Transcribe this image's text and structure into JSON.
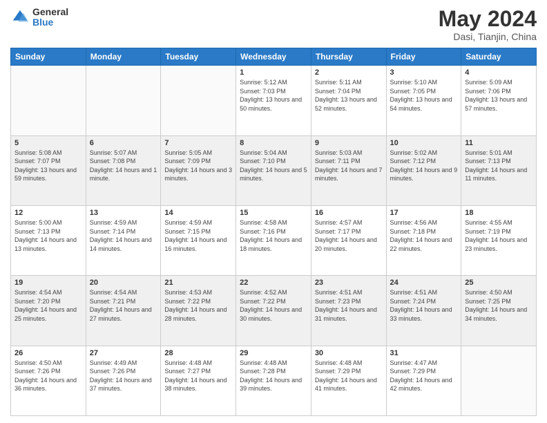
{
  "header": {
    "logo_general": "General",
    "logo_blue": "Blue",
    "month_title": "May 2024",
    "location": "Dasi, Tianjin, China"
  },
  "calendar": {
    "headers": [
      "Sunday",
      "Monday",
      "Tuesday",
      "Wednesday",
      "Thursday",
      "Friday",
      "Saturday"
    ],
    "rows": [
      [
        {
          "day": "",
          "sunrise": "",
          "sunset": "",
          "daylight": ""
        },
        {
          "day": "",
          "sunrise": "",
          "sunset": "",
          "daylight": ""
        },
        {
          "day": "",
          "sunrise": "",
          "sunset": "",
          "daylight": ""
        },
        {
          "day": "1",
          "sunrise": "Sunrise: 5:12 AM",
          "sunset": "Sunset: 7:03 PM",
          "daylight": "Daylight: 13 hours and 50 minutes."
        },
        {
          "day": "2",
          "sunrise": "Sunrise: 5:11 AM",
          "sunset": "Sunset: 7:04 PM",
          "daylight": "Daylight: 13 hours and 52 minutes."
        },
        {
          "day": "3",
          "sunrise": "Sunrise: 5:10 AM",
          "sunset": "Sunset: 7:05 PM",
          "daylight": "Daylight: 13 hours and 54 minutes."
        },
        {
          "day": "4",
          "sunrise": "Sunrise: 5:09 AM",
          "sunset": "Sunset: 7:06 PM",
          "daylight": "Daylight: 13 hours and 57 minutes."
        }
      ],
      [
        {
          "day": "5",
          "sunrise": "Sunrise: 5:08 AM",
          "sunset": "Sunset: 7:07 PM",
          "daylight": "Daylight: 13 hours and 59 minutes."
        },
        {
          "day": "6",
          "sunrise": "Sunrise: 5:07 AM",
          "sunset": "Sunset: 7:08 PM",
          "daylight": "Daylight: 14 hours and 1 minute."
        },
        {
          "day": "7",
          "sunrise": "Sunrise: 5:05 AM",
          "sunset": "Sunset: 7:09 PM",
          "daylight": "Daylight: 14 hours and 3 minutes."
        },
        {
          "day": "8",
          "sunrise": "Sunrise: 5:04 AM",
          "sunset": "Sunset: 7:10 PM",
          "daylight": "Daylight: 14 hours and 5 minutes."
        },
        {
          "day": "9",
          "sunrise": "Sunrise: 5:03 AM",
          "sunset": "Sunset: 7:11 PM",
          "daylight": "Daylight: 14 hours and 7 minutes."
        },
        {
          "day": "10",
          "sunrise": "Sunrise: 5:02 AM",
          "sunset": "Sunset: 7:12 PM",
          "daylight": "Daylight: 14 hours and 9 minutes."
        },
        {
          "day": "11",
          "sunrise": "Sunrise: 5:01 AM",
          "sunset": "Sunset: 7:13 PM",
          "daylight": "Daylight: 14 hours and 11 minutes."
        }
      ],
      [
        {
          "day": "12",
          "sunrise": "Sunrise: 5:00 AM",
          "sunset": "Sunset: 7:13 PM",
          "daylight": "Daylight: 14 hours and 13 minutes."
        },
        {
          "day": "13",
          "sunrise": "Sunrise: 4:59 AM",
          "sunset": "Sunset: 7:14 PM",
          "daylight": "Daylight: 14 hours and 14 minutes."
        },
        {
          "day": "14",
          "sunrise": "Sunrise: 4:59 AM",
          "sunset": "Sunset: 7:15 PM",
          "daylight": "Daylight: 14 hours and 16 minutes."
        },
        {
          "day": "15",
          "sunrise": "Sunrise: 4:58 AM",
          "sunset": "Sunset: 7:16 PM",
          "daylight": "Daylight: 14 hours and 18 minutes."
        },
        {
          "day": "16",
          "sunrise": "Sunrise: 4:57 AM",
          "sunset": "Sunset: 7:17 PM",
          "daylight": "Daylight: 14 hours and 20 minutes."
        },
        {
          "day": "17",
          "sunrise": "Sunrise: 4:56 AM",
          "sunset": "Sunset: 7:18 PM",
          "daylight": "Daylight: 14 hours and 22 minutes."
        },
        {
          "day": "18",
          "sunrise": "Sunrise: 4:55 AM",
          "sunset": "Sunset: 7:19 PM",
          "daylight": "Daylight: 14 hours and 23 minutes."
        }
      ],
      [
        {
          "day": "19",
          "sunrise": "Sunrise: 4:54 AM",
          "sunset": "Sunset: 7:20 PM",
          "daylight": "Daylight: 14 hours and 25 minutes."
        },
        {
          "day": "20",
          "sunrise": "Sunrise: 4:54 AM",
          "sunset": "Sunset: 7:21 PM",
          "daylight": "Daylight: 14 hours and 27 minutes."
        },
        {
          "day": "21",
          "sunrise": "Sunrise: 4:53 AM",
          "sunset": "Sunset: 7:22 PM",
          "daylight": "Daylight: 14 hours and 28 minutes."
        },
        {
          "day": "22",
          "sunrise": "Sunrise: 4:52 AM",
          "sunset": "Sunset: 7:22 PM",
          "daylight": "Daylight: 14 hours and 30 minutes."
        },
        {
          "day": "23",
          "sunrise": "Sunrise: 4:51 AM",
          "sunset": "Sunset: 7:23 PM",
          "daylight": "Daylight: 14 hours and 31 minutes."
        },
        {
          "day": "24",
          "sunrise": "Sunrise: 4:51 AM",
          "sunset": "Sunset: 7:24 PM",
          "daylight": "Daylight: 14 hours and 33 minutes."
        },
        {
          "day": "25",
          "sunrise": "Sunrise: 4:50 AM",
          "sunset": "Sunset: 7:25 PM",
          "daylight": "Daylight: 14 hours and 34 minutes."
        }
      ],
      [
        {
          "day": "26",
          "sunrise": "Sunrise: 4:50 AM",
          "sunset": "Sunset: 7:26 PM",
          "daylight": "Daylight: 14 hours and 36 minutes."
        },
        {
          "day": "27",
          "sunrise": "Sunrise: 4:49 AM",
          "sunset": "Sunset: 7:26 PM",
          "daylight": "Daylight: 14 hours and 37 minutes."
        },
        {
          "day": "28",
          "sunrise": "Sunrise: 4:48 AM",
          "sunset": "Sunset: 7:27 PM",
          "daylight": "Daylight: 14 hours and 38 minutes."
        },
        {
          "day": "29",
          "sunrise": "Sunrise: 4:48 AM",
          "sunset": "Sunset: 7:28 PM",
          "daylight": "Daylight: 14 hours and 39 minutes."
        },
        {
          "day": "30",
          "sunrise": "Sunrise: 4:48 AM",
          "sunset": "Sunset: 7:29 PM",
          "daylight": "Daylight: 14 hours and 41 minutes."
        },
        {
          "day": "31",
          "sunrise": "Sunrise: 4:47 AM",
          "sunset": "Sunset: 7:29 PM",
          "daylight": "Daylight: 14 hours and 42 minutes."
        },
        {
          "day": "",
          "sunrise": "",
          "sunset": "",
          "daylight": ""
        }
      ]
    ]
  }
}
